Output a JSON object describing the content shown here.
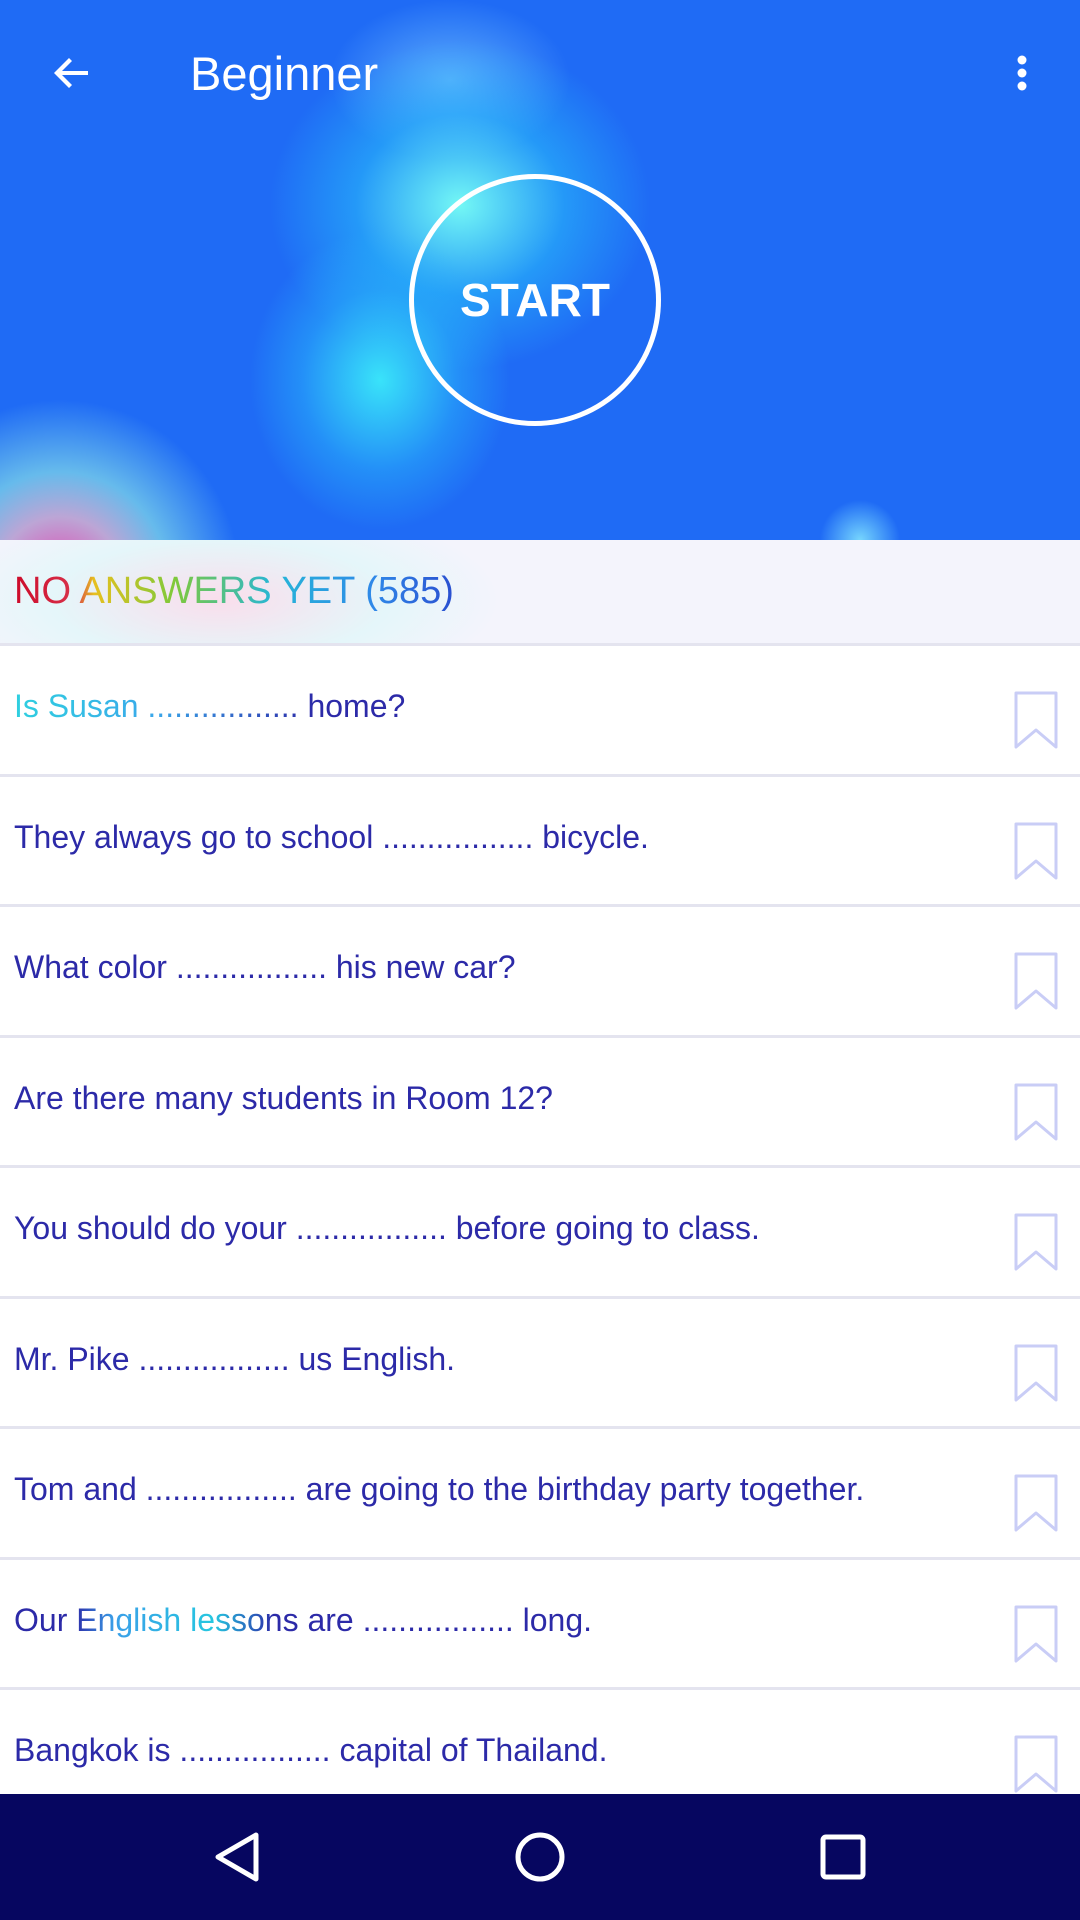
{
  "colors": {
    "header_bg": "#1f6bf5",
    "question_text": "#2c2aa8",
    "bookmark_outline": "#c9cdf6",
    "navbar_bg": "#060660"
  },
  "header": {
    "title": "Beginner",
    "back_icon": "arrow-left-icon",
    "menu_icon": "more-vert-icon"
  },
  "start": {
    "label": "START"
  },
  "section": {
    "title": "NO ANSWERS YET (585)"
  },
  "questions": [
    {
      "text": "Is Susan ................. home?",
      "icon": "bookmark-outline-icon"
    },
    {
      "text": "They always go to school ................. bicycle.",
      "icon": "bookmark-outline-icon"
    },
    {
      "text": "What color ................. his new car?",
      "icon": "bookmark-outline-icon"
    },
    {
      "text": "Are there many students in Room 12?",
      "icon": "bookmark-outline-icon"
    },
    {
      "text": "You should do your ................. before going to class.",
      "icon": "bookmark-outline-icon"
    },
    {
      "text": "Mr. Pike ................. us English.",
      "icon": "bookmark-outline-icon"
    },
    {
      "text": "Tom and ................. are going to the birthday party together.",
      "icon": "bookmark-outline-icon"
    },
    {
      "text": "Our English lessons are ................. long.",
      "icon": "bookmark-outline-icon"
    },
    {
      "text": "Bangkok is ................. capital of Thailand.",
      "icon": "bookmark-outline-icon"
    }
  ],
  "navbar": {
    "back_icon": "nav-back-triangle-icon",
    "home_icon": "nav-home-circle-icon",
    "recents_icon": "nav-recents-square-icon"
  }
}
